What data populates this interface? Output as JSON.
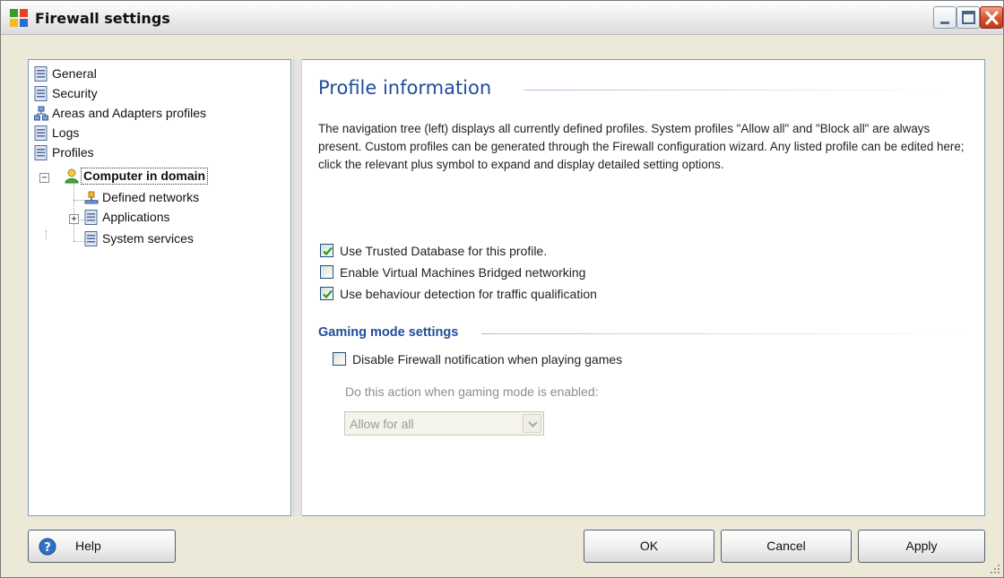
{
  "window": {
    "title": "Firewall settings"
  },
  "tree": {
    "items": [
      {
        "label": "General",
        "icon": "list-page-icon"
      },
      {
        "label": "Security",
        "icon": "list-page-icon"
      },
      {
        "label": "Areas and Adapters profiles",
        "icon": "network-adapters-icon"
      },
      {
        "label": "Logs",
        "icon": "list-page-icon"
      },
      {
        "label": "Profiles",
        "icon": "list-page-icon"
      },
      {
        "label": "Computer in domain",
        "icon": "user-profile-icon",
        "selected": true,
        "expanded": true
      },
      {
        "label": "Defined networks",
        "icon": "network-icon"
      },
      {
        "label": "Applications",
        "icon": "list-page-icon",
        "expanded": false
      },
      {
        "label": "System services",
        "icon": "list-page-icon"
      }
    ]
  },
  "content": {
    "title": "Profile information",
    "description": "The navigation tree (left) displays all currently defined profiles. System profiles \"Allow all\" and \"Block all\" are always present. Custom profiles can be generated through the Firewall configuration wizard. Any listed profile can be edited here; click the relevant plus symbol to expand and display detailed setting options.",
    "options": [
      {
        "label": "Use Trusted Database for this profile.",
        "checked": true
      },
      {
        "label": "Enable Virtual Machines Bridged networking",
        "checked": false
      },
      {
        "label": "Use behaviour detection for traffic qualification",
        "checked": true
      }
    ],
    "gaming": {
      "title": "Gaming mode settings",
      "disable_notification_label": "Disable Firewall notification when playing games",
      "disable_notification_checked": false,
      "action_label": "Do this action when gaming mode is enabled:",
      "action_value": "Allow for all"
    }
  },
  "buttons": {
    "help": "Help",
    "ok": "OK",
    "cancel": "Cancel",
    "apply": "Apply"
  },
  "colors": {
    "accent_title": "#1f4e9a",
    "title_bar": "#ececec",
    "close_button": "#d9512d",
    "check_mark": "#21a121"
  }
}
